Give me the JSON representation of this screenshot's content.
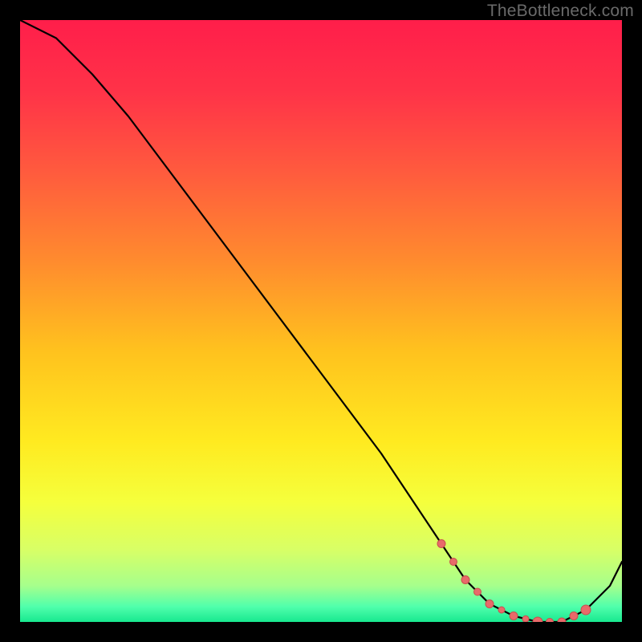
{
  "watermark": "TheBottleneck.com",
  "colors": {
    "background": "#000000",
    "gradient_stops": [
      {
        "offset": 0.0,
        "color": "#ff1e4a"
      },
      {
        "offset": 0.12,
        "color": "#ff3348"
      },
      {
        "offset": 0.25,
        "color": "#ff5a3e"
      },
      {
        "offset": 0.4,
        "color": "#ff8b2e"
      },
      {
        "offset": 0.55,
        "color": "#ffc21e"
      },
      {
        "offset": 0.7,
        "color": "#ffea20"
      },
      {
        "offset": 0.8,
        "color": "#f5ff3c"
      },
      {
        "offset": 0.88,
        "color": "#d8ff66"
      },
      {
        "offset": 0.94,
        "color": "#a6ff8c"
      },
      {
        "offset": 0.975,
        "color": "#4fffac"
      },
      {
        "offset": 1.0,
        "color": "#18e88f"
      }
    ],
    "curve": "#000000",
    "marker_fill": "#e86a6a",
    "marker_stroke": "#c94e4e"
  },
  "chart_data": {
    "type": "line",
    "title": "",
    "xlabel": "",
    "ylabel": "",
    "xlim": [
      0,
      100
    ],
    "ylim": [
      0,
      100
    ],
    "series": [
      {
        "name": "bottleneck-curve",
        "x": [
          0,
          6,
          12,
          18,
          24,
          30,
          36,
          42,
          48,
          54,
          60,
          66,
          70,
          74,
          78,
          82,
          86,
          90,
          94,
          98,
          100
        ],
        "y": [
          100,
          97,
          91,
          84,
          76,
          68,
          60,
          52,
          44,
          36,
          28,
          19,
          13,
          7,
          3,
          1,
          0,
          0,
          2,
          6,
          10
        ]
      }
    ],
    "markers": {
      "name": "highlighted-points",
      "x": [
        70,
        72,
        74,
        76,
        78,
        80,
        82,
        84,
        86,
        88,
        90,
        92,
        94
      ],
      "y": [
        13,
        10,
        7,
        5,
        3,
        2,
        1,
        0.5,
        0,
        0,
        0,
        1,
        2
      ],
      "r": [
        5,
        4.5,
        5,
        4.5,
        5,
        4,
        5,
        4,
        6,
        4.5,
        5,
        5,
        6
      ]
    }
  }
}
